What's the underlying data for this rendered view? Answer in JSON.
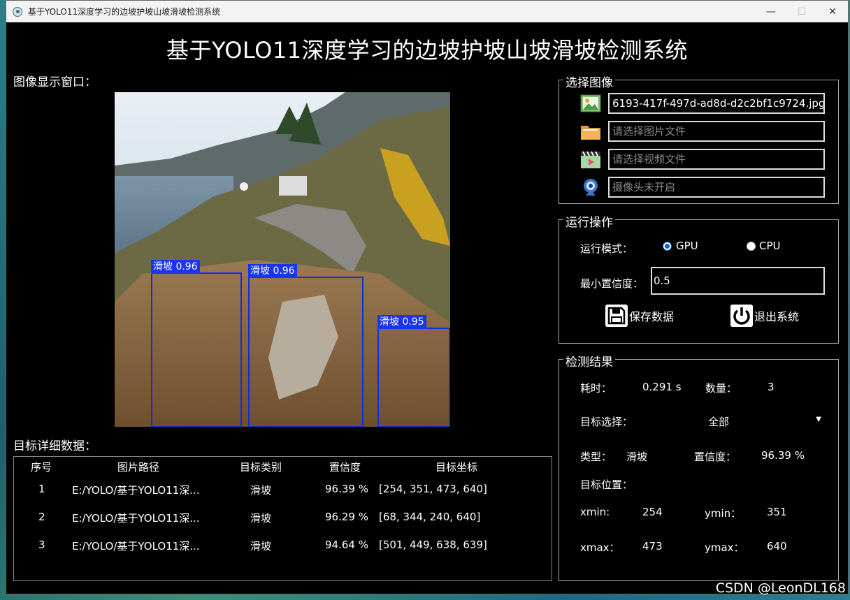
{
  "window": {
    "title": "基于YOLO11深度学习的边坡护坡山坡滑坡检测系统",
    "minimize": "—",
    "maximize": "☐",
    "close": "✕"
  },
  "heading": "基于YOLO11深度学习的边坡护坡山坡滑坡检测系统",
  "image_panel": {
    "label": "图像显示窗口：",
    "detections": [
      {
        "label": "滑坡 0.96"
      },
      {
        "label": "滑坡 0.96"
      },
      {
        "label": "滑坡 0.95"
      }
    ]
  },
  "table": {
    "label": "目标详细数据：",
    "headers": [
      "序号",
      "图片路径",
      "目标类别",
      "置信度",
      "目标坐标"
    ],
    "rows": [
      {
        "index": "1",
        "path": "E:/YOLO/基于YOLO11深...",
        "cls": "滑坡",
        "conf": "96.39 %",
        "coords": "[254, 351, 473, 640]"
      },
      {
        "index": "2",
        "path": "E:/YOLO/基于YOLO11深...",
        "cls": "滑坡",
        "conf": "96.29 %",
        "coords": "[68, 344, 240, 640]"
      },
      {
        "index": "3",
        "path": "E:/YOLO/基于YOLO11深...",
        "cls": "滑坡",
        "conf": "94.64 %",
        "coords": "[501, 449, 638, 639]"
      }
    ]
  },
  "select_image": {
    "title": "选择图像",
    "image_file": "6193-417f-497d-ad8d-d2c2bf1c9724.jpg",
    "folder_placeholder": "请选择图片文件",
    "video_placeholder": "请选择视频文件",
    "camera_placeholder": "摄像头未开启"
  },
  "run_ops": {
    "title": "运行操作",
    "mode_label": "运行模式：",
    "gpu": "GPU",
    "cpu": "CPU",
    "selected_mode": "GPU",
    "min_conf_label": "最小置信度：",
    "min_conf": "0.5",
    "save_label": "保存数据",
    "exit_label": "退出系统"
  },
  "result": {
    "title": "检测结果",
    "time_label": "耗时：",
    "time_value": "0.291 s",
    "count_label": "数量：",
    "count_value": "3",
    "target_select_label": "目标选择：",
    "target_select_value": "全部",
    "type_label": "类型：",
    "type_value": "滑坡",
    "conf_label": "置信度：",
    "conf_value": "96.39 %",
    "pos_label": "目标位置：",
    "xmin_label": "xmin:",
    "xmin": "254",
    "ymin_label": "ymin：",
    "ymin": "351",
    "xmax_label": "xmax：",
    "xmax": "473",
    "ymax_label": "ymax：",
    "ymax": "640"
  },
  "watermark": "CSDN @LeonDL168"
}
